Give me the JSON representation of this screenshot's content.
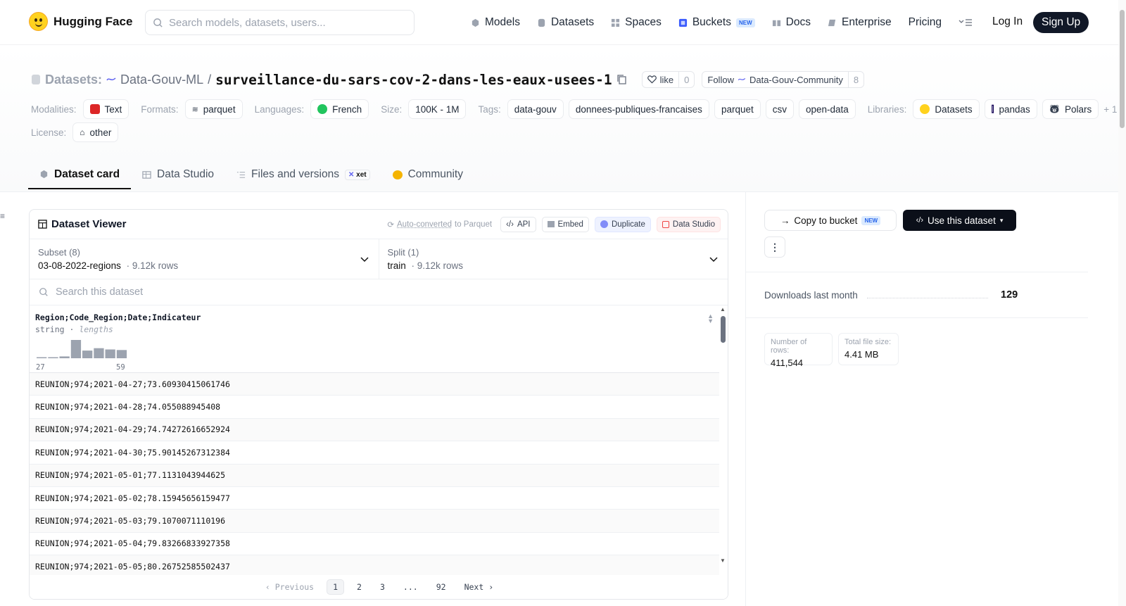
{
  "nav": {
    "logo_text": "Hugging Face",
    "search_placeholder": "Search models, datasets, users...",
    "items": [
      {
        "label": "Models",
        "icon": "cube-icon"
      },
      {
        "label": "Datasets",
        "icon": "database-icon"
      },
      {
        "label": "Spaces",
        "icon": "grid-icon"
      },
      {
        "label": "Buckets",
        "icon": "bucket-icon",
        "badge": "NEW"
      },
      {
        "label": "Docs",
        "icon": "book-icon"
      },
      {
        "label": "Enterprise",
        "icon": "enterprise-icon"
      },
      {
        "label": "Pricing"
      }
    ],
    "login": "Log In",
    "signup": "Sign Up"
  },
  "repo": {
    "type_label": "Datasets:",
    "owner": "Data-Gouv-ML",
    "separator": "/",
    "name": "surveillance-du-sars-cov-2-dans-les-eaux-usees-1",
    "like_label": "like",
    "like_count": "0",
    "follow_label": "Follow",
    "follow_org": "Data-Gouv-Community",
    "follow_count": "8"
  },
  "meta": {
    "modalities_label": "Modalities:",
    "modalities": [
      "Text"
    ],
    "formats_label": "Formats:",
    "formats": [
      "parquet"
    ],
    "languages_label": "Languages:",
    "languages": [
      "French"
    ],
    "size_label": "Size:",
    "size": "100K - 1M",
    "tags_label": "Tags:",
    "tags": [
      "data-gouv",
      "donnees-publiques-francaises",
      "parquet",
      "csv",
      "open-data"
    ],
    "libraries_label": "Libraries:",
    "libraries": [
      "Datasets",
      "pandas",
      "Polars"
    ],
    "libraries_more": "+ 1",
    "license_label": "License:",
    "license": "other"
  },
  "tabs": [
    {
      "label": "Dataset card",
      "active": true
    },
    {
      "label": "Data Studio"
    },
    {
      "label": "Files and versions",
      "badge": "xet"
    },
    {
      "label": "Community"
    }
  ],
  "viewer": {
    "title": "Dataset Viewer",
    "auto_converted": "Auto-converted",
    "auto_suffix": "to Parquet",
    "api": "API",
    "embed": "Embed",
    "duplicate": "Duplicate",
    "data_studio": "Data Studio",
    "subset_label": "Subset (8)",
    "subset_value": "03-08-2022-regions",
    "subset_rows": "9.12k rows",
    "split_label": "Split (1)",
    "split_value": "train",
    "split_rows": "9.12k rows",
    "search_placeholder": "Search this dataset",
    "column": {
      "name": "Region;Code_Region;Date;Indicateur",
      "type": "string",
      "stat": "lengths",
      "hist_min": "27",
      "hist_max": "59",
      "histogram": [
        0.03,
        0.03,
        0.1,
        1.0,
        0.42,
        0.55,
        0.48,
        0.45
      ]
    },
    "rows": [
      "REUNION;974;2021-04-27;73.60930415061746",
      "REUNION;974;2021-04-28;74.055088945408",
      "REUNION;974;2021-04-29;74.74272616652924",
      "REUNION;974;2021-04-30;75.90145267312384",
      "REUNION;974;2021-05-01;77.1131043944625",
      "REUNION;974;2021-05-02;78.15945656159477",
      "REUNION;974;2021-05-03;79.1070071110196",
      "REUNION;974;2021-05-04;79.83266833927358",
      "REUNION;974;2021-05-05;80.26752585502437"
    ],
    "pager": {
      "previous": "Previous",
      "pages": [
        "1",
        "2",
        "3",
        "...",
        "92"
      ],
      "next": "Next"
    }
  },
  "side": {
    "copy_label": "Copy to bucket",
    "copy_badge": "NEW",
    "use_label": "Use this dataset",
    "downloads_label": "Downloads last month",
    "downloads_value": "129",
    "rows_label": "Number of rows:",
    "rows_value": "411,544",
    "size_label": "Total file size:",
    "size_value": "4.41 MB"
  },
  "colors": {
    "accent_dark": "#111827",
    "brand_yellow": "#ffd21e",
    "new_badge": "#2563eb"
  }
}
